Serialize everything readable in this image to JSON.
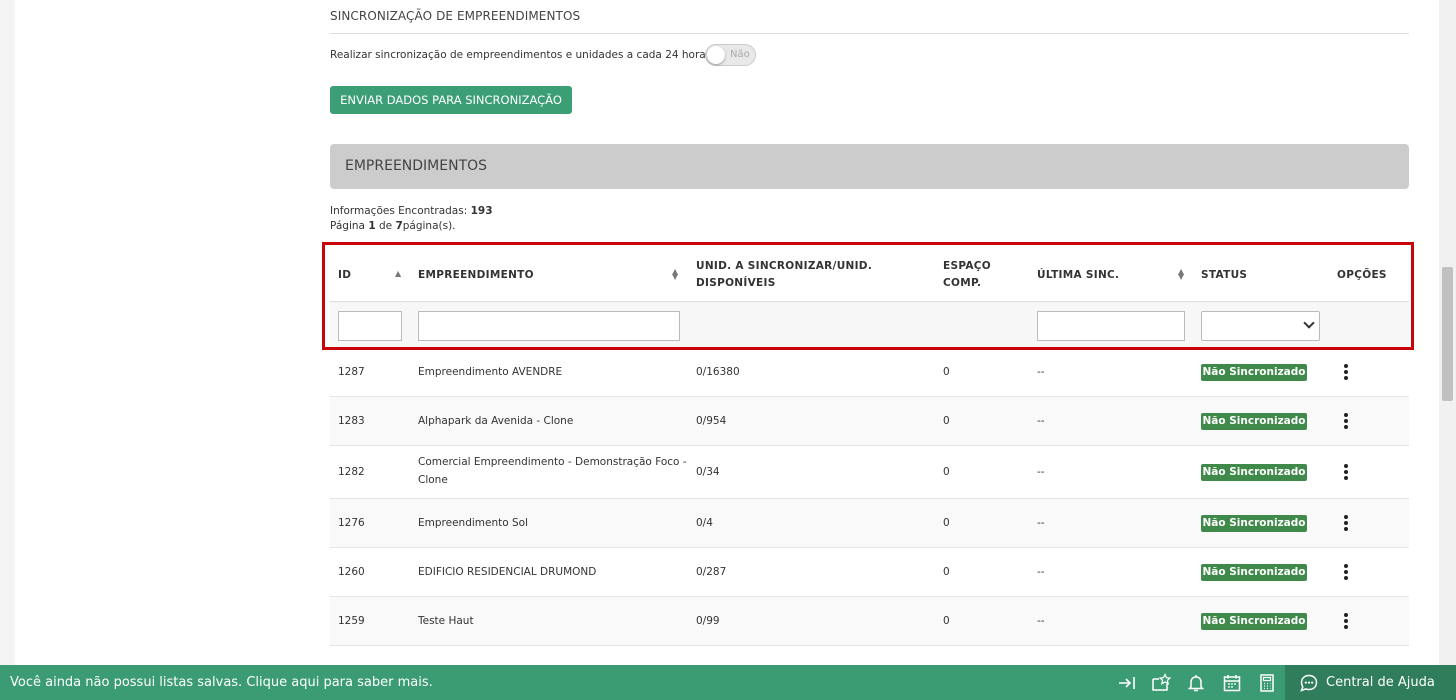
{
  "sync_section": {
    "title": "SINCRONIZAÇÃO DE EMPREENDIMENTOS",
    "description": "Realizar sincronização de empreendimentos e unidades a cada 24 horas.",
    "toggle_label": "Não",
    "toggle_on": false,
    "send_button": "ENVIAR DADOS PARA SINCRONIZAÇÃO"
  },
  "panel": {
    "title": "EMPREENDIMENTOS"
  },
  "info": {
    "found_label": "Informações Encontradas:",
    "found_count": "193",
    "page_label": "Página",
    "page_current": "1",
    "page_of": "de",
    "page_total": "7",
    "page_suffix": "página(s)."
  },
  "table": {
    "columns": {
      "id": "ID",
      "empreendimento": "EMPREENDIMENTO",
      "unid_line1": "UNID. A SINCRONIZAR/UNID.",
      "unid_line2": "DISPONÍVEIS",
      "espaco_line1": "ESPAÇO",
      "espaco_line2": "COMP.",
      "ultima": "ÚLTIMA SINC.",
      "status": "STATUS",
      "opcoes": "OPÇÕES"
    },
    "rows": [
      {
        "id": "1287",
        "name": "Empreendimento AVENDRE",
        "name2": "",
        "unid": "0/16380",
        "espaco": "0",
        "ultima": "--",
        "status": "Não Sincronizado"
      },
      {
        "id": "1283",
        "name": "Alphapark da Avenida - Clone",
        "name2": "",
        "unid": "0/954",
        "espaco": "0",
        "ultima": "--",
        "status": "Não Sincronizado"
      },
      {
        "id": "1282",
        "name": "Comercial Empreendimento - Demonstração Foco -",
        "name2": "Clone",
        "unid": "0/34",
        "espaco": "0",
        "ultima": "--",
        "status": "Não Sincronizado"
      },
      {
        "id": "1276",
        "name": "Empreendimento Sol",
        "name2": "",
        "unid": "0/4",
        "espaco": "0",
        "ultima": "--",
        "status": "Não Sincronizado"
      },
      {
        "id": "1260",
        "name": "EDIFICIO RESIDENCIAL DRUMOND",
        "name2": "",
        "unid": "0/287",
        "espaco": "0",
        "ultima": "--",
        "status": "Não Sincronizado"
      },
      {
        "id": "1259",
        "name": "Teste Haut",
        "name2": "",
        "unid": "0/99",
        "espaco": "0",
        "ultima": "--",
        "status": "Não Sincronizado"
      }
    ]
  },
  "footer": {
    "saved_lists_text": "Você ainda não possui listas salvas. Clique aqui para saber mais.",
    "help_label": "Central de Ajuda",
    "icons": [
      "collapse-arrow-icon",
      "star-list-icon",
      "bell-icon",
      "calendar-icon",
      "calculator-icon",
      "chat-icon"
    ]
  },
  "colors": {
    "accent": "#3c9e74",
    "status_badge": "#3f8a4a",
    "highlight": "#c8040a",
    "footer_dark": "#2f7d5b"
  }
}
